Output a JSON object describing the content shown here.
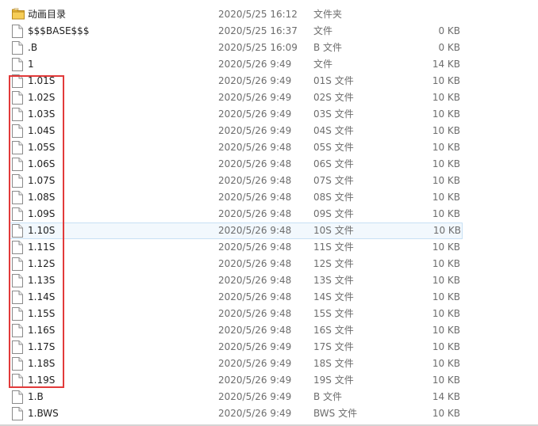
{
  "colors": {
    "highlight": "#e23a3a",
    "hover_bg": "#f2f8fd",
    "hover_border": "#c7e0f4",
    "folder": "#e8b83a"
  },
  "files": [
    {
      "name": "动画目录",
      "date": "2020/5/25 16:12",
      "type": "文件夹",
      "size": "",
      "icon": "folder-icon"
    },
    {
      "name": "$$$BASE$$$",
      "date": "2020/5/25 16:37",
      "type": "文件",
      "size": "0 KB",
      "icon": "file-icon"
    },
    {
      "name": ".B",
      "date": "2020/5/25 16:09",
      "type": "B 文件",
      "size": "0 KB",
      "icon": "file-icon"
    },
    {
      "name": "1",
      "date": "2020/5/26 9:49",
      "type": "文件",
      "size": "14 KB",
      "icon": "file-icon"
    },
    {
      "name": "1.01S",
      "date": "2020/5/26 9:49",
      "type": "01S 文件",
      "size": "10 KB",
      "icon": "file-icon"
    },
    {
      "name": "1.02S",
      "date": "2020/5/26 9:49",
      "type": "02S 文件",
      "size": "10 KB",
      "icon": "file-icon"
    },
    {
      "name": "1.03S",
      "date": "2020/5/26 9:49",
      "type": "03S 文件",
      "size": "10 KB",
      "icon": "file-icon"
    },
    {
      "name": "1.04S",
      "date": "2020/5/26 9:49",
      "type": "04S 文件",
      "size": "10 KB",
      "icon": "file-icon"
    },
    {
      "name": "1.05S",
      "date": "2020/5/26 9:48",
      "type": "05S 文件",
      "size": "10 KB",
      "icon": "file-icon"
    },
    {
      "name": "1.06S",
      "date": "2020/5/26 9:48",
      "type": "06S 文件",
      "size": "10 KB",
      "icon": "file-icon"
    },
    {
      "name": "1.07S",
      "date": "2020/5/26 9:48",
      "type": "07S 文件",
      "size": "10 KB",
      "icon": "file-icon"
    },
    {
      "name": "1.08S",
      "date": "2020/5/26 9:48",
      "type": "08S 文件",
      "size": "10 KB",
      "icon": "file-icon"
    },
    {
      "name": "1.09S",
      "date": "2020/5/26 9:48",
      "type": "09S 文件",
      "size": "10 KB",
      "icon": "file-icon"
    },
    {
      "name": "1.10S",
      "date": "2020/5/26 9:48",
      "type": "10S 文件",
      "size": "10 KB",
      "icon": "file-icon",
      "hovered": true
    },
    {
      "name": "1.11S",
      "date": "2020/5/26 9:48",
      "type": "11S 文件",
      "size": "10 KB",
      "icon": "file-icon"
    },
    {
      "name": "1.12S",
      "date": "2020/5/26 9:48",
      "type": "12S 文件",
      "size": "10 KB",
      "icon": "file-icon"
    },
    {
      "name": "1.13S",
      "date": "2020/5/26 9:48",
      "type": "13S 文件",
      "size": "10 KB",
      "icon": "file-icon"
    },
    {
      "name": "1.14S",
      "date": "2020/5/26 9:48",
      "type": "14S 文件",
      "size": "10 KB",
      "icon": "file-icon"
    },
    {
      "name": "1.15S",
      "date": "2020/5/26 9:48",
      "type": "15S 文件",
      "size": "10 KB",
      "icon": "file-icon"
    },
    {
      "name": "1.16S",
      "date": "2020/5/26 9:48",
      "type": "16S 文件",
      "size": "10 KB",
      "icon": "file-icon"
    },
    {
      "name": "1.17S",
      "date": "2020/5/26 9:49",
      "type": "17S 文件",
      "size": "10 KB",
      "icon": "file-icon"
    },
    {
      "name": "1.18S",
      "date": "2020/5/26 9:49",
      "type": "18S 文件",
      "size": "10 KB",
      "icon": "file-icon"
    },
    {
      "name": "1.19S",
      "date": "2020/5/26 9:49",
      "type": "19S 文件",
      "size": "10 KB",
      "icon": "file-icon"
    },
    {
      "name": "1.B",
      "date": "2020/5/26 9:49",
      "type": "B 文件",
      "size": "14 KB",
      "icon": "file-icon"
    },
    {
      "name": "1.BWS",
      "date": "2020/5/26 9:49",
      "type": "BWS 文件",
      "size": "10 KB",
      "icon": "file-icon"
    }
  ]
}
